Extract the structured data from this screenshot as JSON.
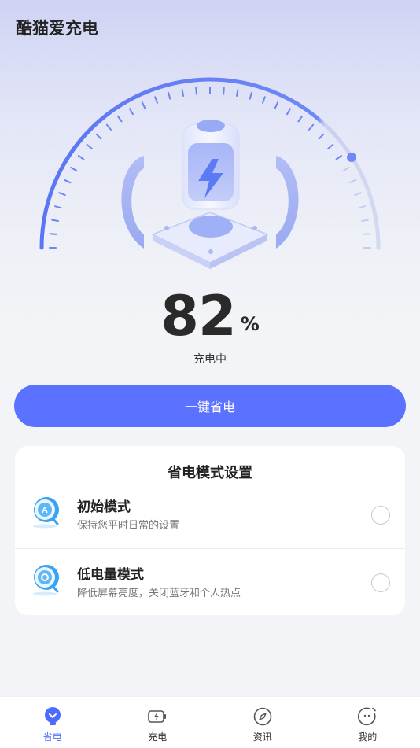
{
  "app": {
    "title": "酷猫爱充电"
  },
  "battery": {
    "percent": "82",
    "unit": "%",
    "status": "充电中"
  },
  "actions": {
    "save_label": "一键省电"
  },
  "mode_card": {
    "title": "省电模式设置",
    "modes": [
      {
        "name": "初始模式",
        "desc": "保持您平时日常的设置",
        "selected": false
      },
      {
        "name": "低电量模式",
        "desc": "降低屏幕亮度，关闭蓝牙和个人热点",
        "selected": false
      }
    ]
  },
  "tabs": [
    {
      "label": "省电",
      "icon": "bulb-icon",
      "active": true
    },
    {
      "label": "充电",
      "icon": "battery-charge-icon",
      "active": false
    },
    {
      "label": "资讯",
      "icon": "compass-icon",
      "active": false
    },
    {
      "label": "我的",
      "icon": "face-icon",
      "active": false
    }
  ],
  "colors": {
    "accent": "#5a72ff",
    "tab_active": "#4e6bff",
    "gauge": "#6d86f6"
  }
}
